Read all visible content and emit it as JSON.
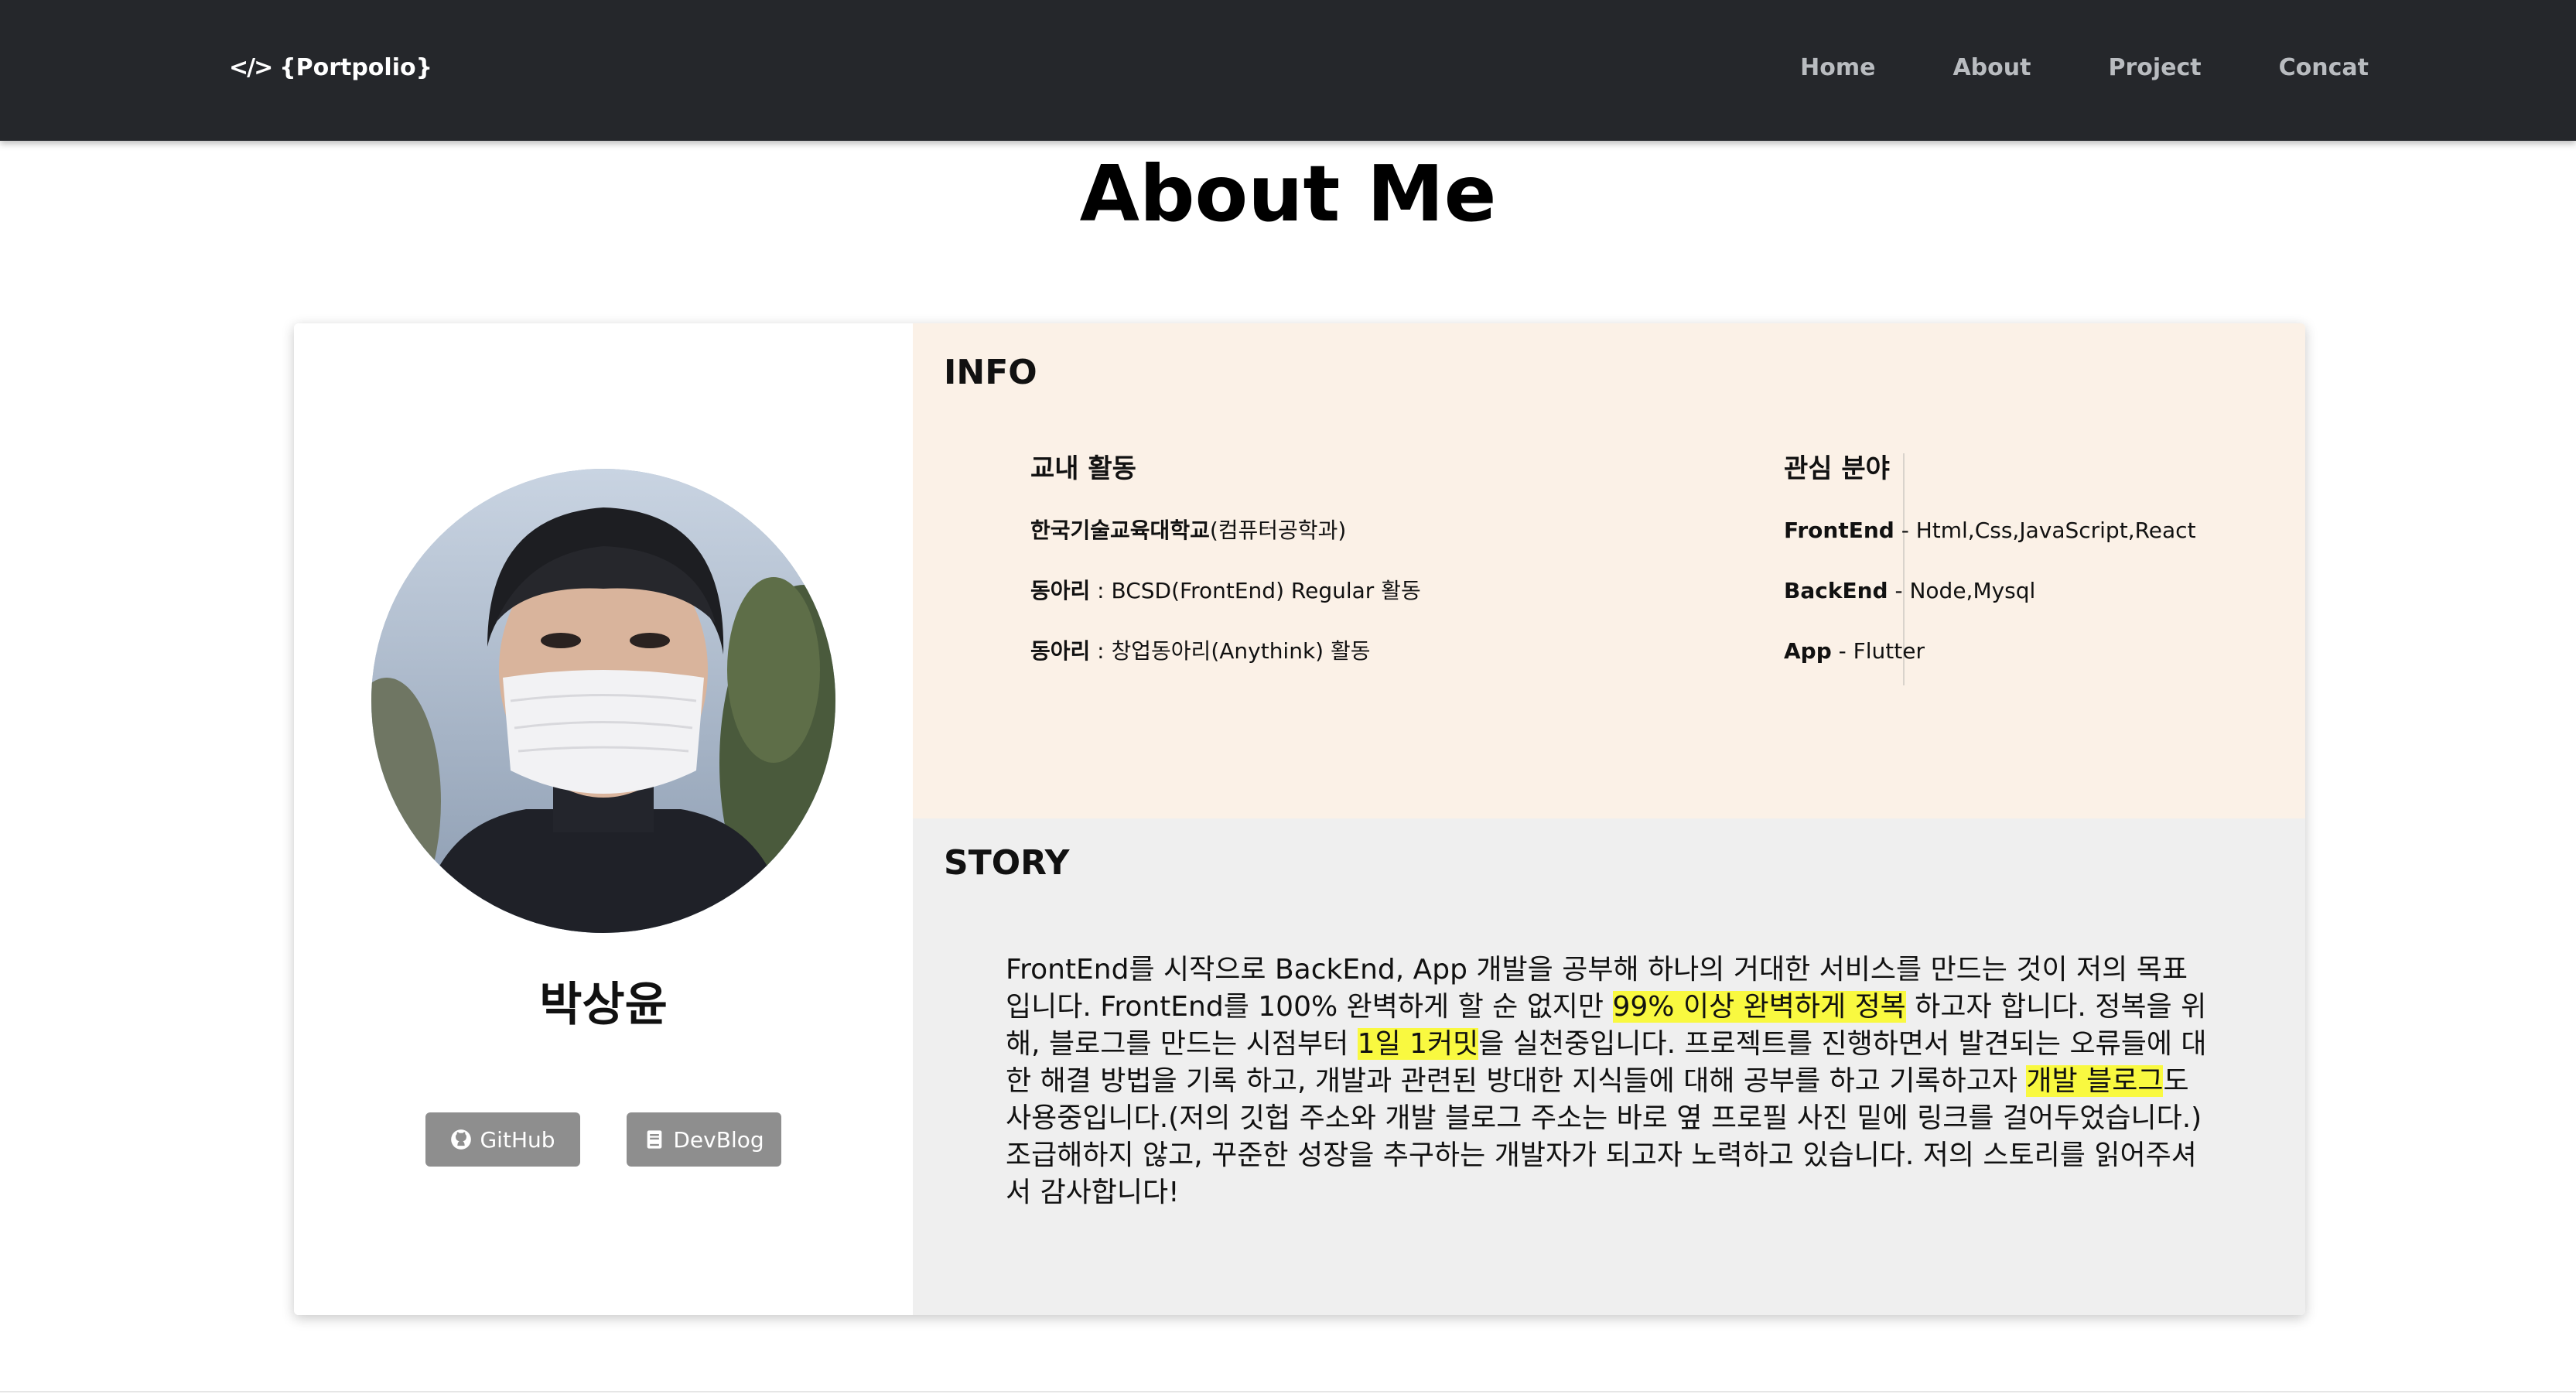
{
  "navbar": {
    "brand_icon": "</>",
    "brand_text": "{Portpolio}",
    "links": [
      "Home",
      "About",
      "Project",
      "Concat"
    ],
    "background": "#25272b"
  },
  "page": {
    "title": "About Me"
  },
  "profile": {
    "name": "박상윤",
    "buttons": {
      "github": {
        "label": "GitHub",
        "icon": "github-icon"
      },
      "blog": {
        "label": "DevBlog",
        "icon": "book-icon"
      }
    },
    "button_color": "#8e8e8e"
  },
  "info": {
    "title": "INFO",
    "background": "#fbf1e7",
    "left": {
      "heading": "교내 활동",
      "items": [
        {
          "bold": "한국기술교육대학교",
          "text": "(컴퓨터공학과)"
        },
        {
          "bold": "동아리",
          "text": " : BCSD(FrontEnd) Regular 활동"
        },
        {
          "bold": "동아리",
          "text": " : 창업동아리(Anythink) 활동"
        }
      ]
    },
    "right": {
      "heading": "관심 분야",
      "items": [
        {
          "bold": "FrontEnd",
          "text": " - Html,Css,JavaScript,React"
        },
        {
          "bold": "BackEnd",
          "text": " - Node,Mysql"
        },
        {
          "bold": "App",
          "text": " - Flutter"
        }
      ]
    }
  },
  "story": {
    "title": "STORY",
    "background": "#efefef",
    "highlight_color": "#f9f940",
    "parts": [
      {
        "text": "FrontEnd를 시작으로 BackEnd, App 개발을 공부해 하나의 거대한 서비스를 만드는 것이 저의 목표입니다. FrontEnd를 100% 완벽하게 할 순 없지만 ",
        "highlight": false
      },
      {
        "text": "99% 이상 완벽하게 정복",
        "highlight": true
      },
      {
        "text": " 하고자 합니다. 정복을 위해, 블로그를 만드는 시점부터 ",
        "highlight": false
      },
      {
        "text": "1일 1커밋",
        "highlight": true
      },
      {
        "text": "을 실천중입니다. 프로젝트를 진행하면서 발견되는 오류들에 대한 해결 방법을 기록 하고, 개발과 관련된 방대한 지식들에 대해 공부를 하고 기록하고자 ",
        "highlight": false
      },
      {
        "text": "개발 블로그",
        "highlight": true
      },
      {
        "text": "도 사용중입니다.(저의 깃헙 주소와 개발 블로그 주소는 바로 옆 프로필 사진 밑에 링크를 걸어두었습니다.) 조급해하지 않고, 꾸준한 성장을 추구하는 개발자가 되고자 노력하고 있습니다. 저의 스토리를 읽어주셔서 감사합니다!",
        "highlight": false
      }
    ]
  }
}
